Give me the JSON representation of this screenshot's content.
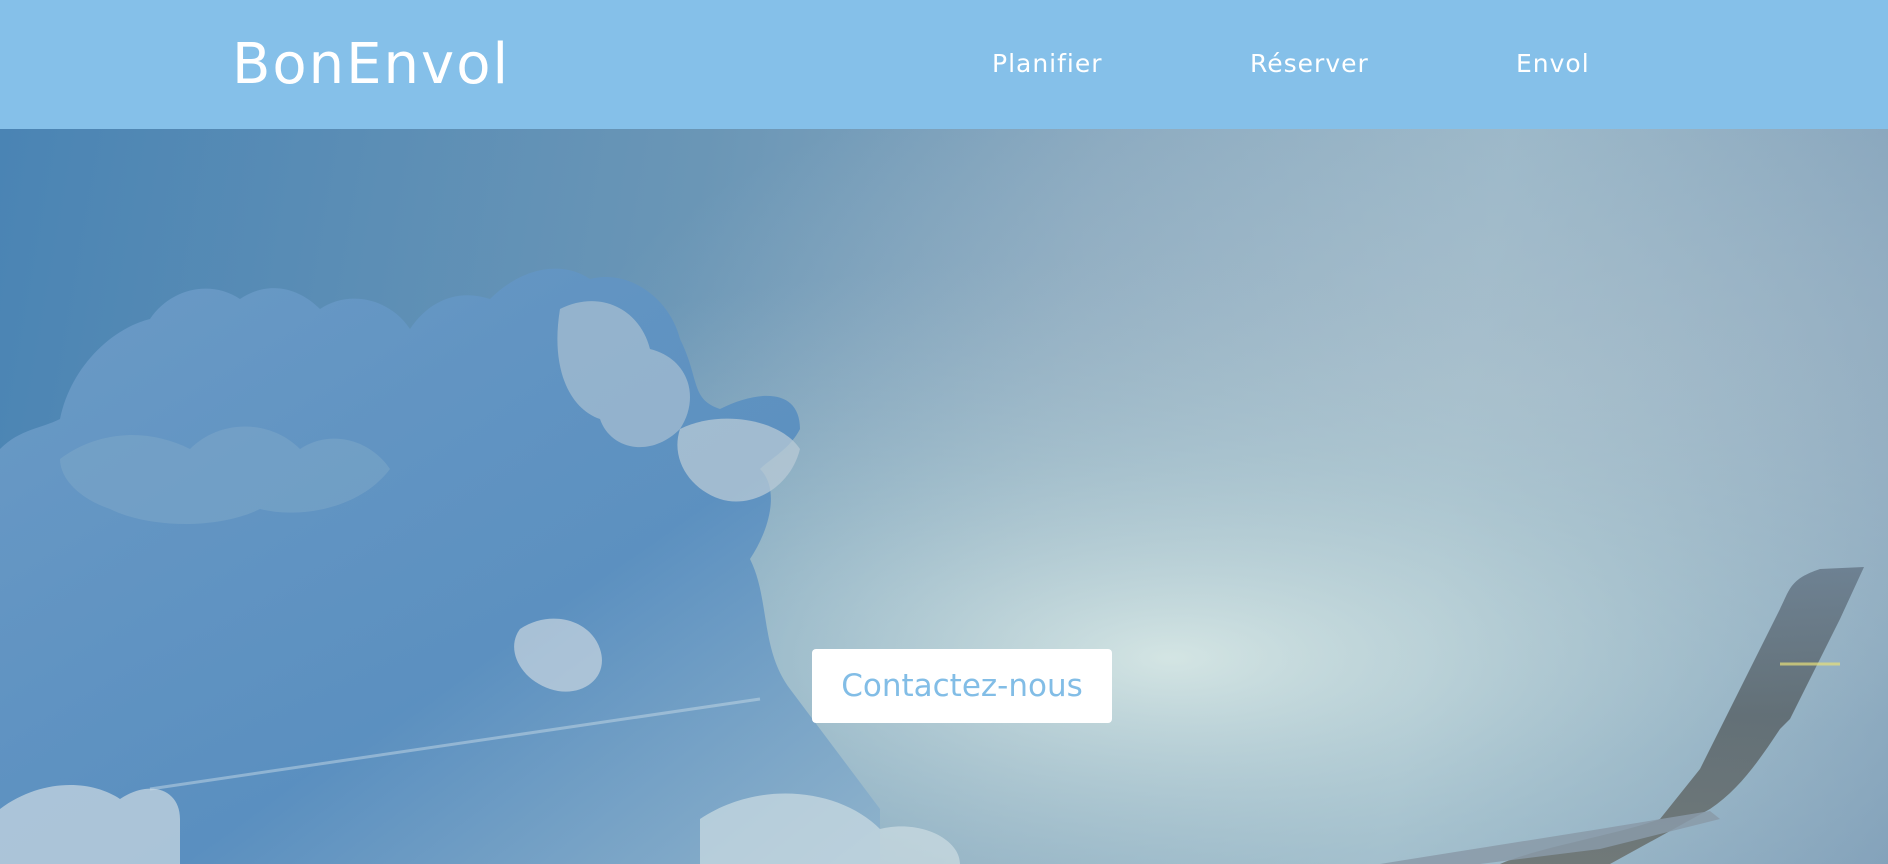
{
  "header": {
    "logo": "BonEnvol",
    "nav": [
      {
        "label": "Planifier"
      },
      {
        "label": "Réserver"
      },
      {
        "label": "Envol"
      }
    ]
  },
  "hero": {
    "cta_label": "Contactez-nous"
  },
  "colors": {
    "header_bg": "#85c0e9",
    "accent": "#82bde6",
    "text_light": "#ffffff"
  }
}
